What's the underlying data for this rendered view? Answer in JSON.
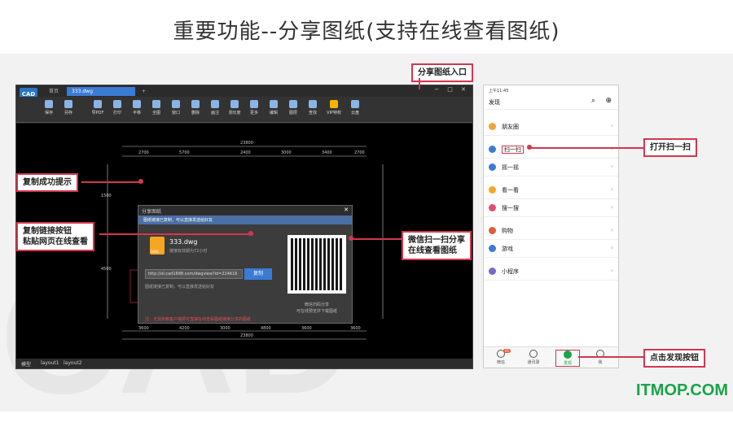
{
  "slide": {
    "title": "重要功能--分享图纸(支持在线查看图纸)",
    "brand": "ITMOP.COM",
    "watermark": "CAD"
  },
  "cad": {
    "logo": "CAD",
    "tabs": [
      "首页",
      "333.dwg",
      "+"
    ],
    "window_buttons": "− □ ✕",
    "toolbar": [
      "保存",
      "另存",
      "导PDF",
      "打印",
      "平移",
      "全图",
      "窗口",
      "缩放",
      "删除",
      "画注",
      "查云线",
      "测长度",
      "删除",
      "更多",
      "编辑",
      "图层",
      "查找",
      "VIP特权",
      "云盘"
    ],
    "toolbar_extra": [
      "打开",
      "导图片",
      "链接"
    ],
    "dims": {
      "top_total": "23800",
      "top_parts": [
        "2700",
        "5700",
        "2400",
        "3000",
        "3400",
        "2700"
      ],
      "bottom_total": "23800",
      "bottom_parts": [
        "3600",
        "4200",
        "3000",
        "4800",
        "3600",
        "3600"
      ],
      "left": [
        "1500",
        "4500"
      ]
    },
    "status": {
      "model": "模型",
      "layout1": "layout1",
      "layout2": "layout2"
    }
  },
  "dialog": {
    "title": "分享图纸",
    "close": "✕",
    "banner": "图纸链接已复制，可以直接发送给好友",
    "file_name": "333.dwg",
    "file_badge": "DWG",
    "validity": "链接有效期为72小时",
    "link": "http://ol.cad1688.com/dwgview?id=224616",
    "copy_button": "复制",
    "copied_hint": "图纸链接已复制，可以直接发送给好友",
    "warning": "注：无需依赖客户端即可直接在线查看图纸链接分享的图纸",
    "qr_caption1": "微信扫码分享",
    "qr_caption2": "可在线预览并下载图纸"
  },
  "callouts": {
    "share_entry": "分享图纸入口",
    "copy_success": "复制成功提示",
    "copy_link_1": "复制链接按钮",
    "copy_link_2": "粘贴网页在线查看",
    "wechat_1": "微信扫一扫分享",
    "wechat_2": "在线查看图纸",
    "open_scan": "打开扫一扫",
    "click_discover": "点击发现按钮"
  },
  "phone": {
    "status": "上午11:45",
    "header": "发现",
    "items": [
      "朋友圈",
      "扫一扫",
      "摇一摇",
      "看一看",
      "搜一搜",
      "购物",
      "游戏",
      "小程序"
    ],
    "tabs": [
      "微信",
      "通讯录",
      "发现",
      "我"
    ],
    "badge": "65"
  }
}
